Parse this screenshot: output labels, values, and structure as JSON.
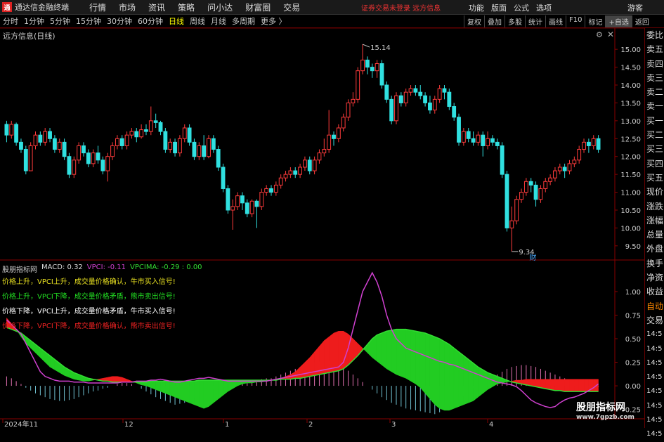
{
  "app": {
    "name": "通达信金融终端",
    "logo_char": "通"
  },
  "top_menu": [
    "行情",
    "市场",
    "资讯",
    "策略",
    "问小达",
    "财富圈",
    "交易"
  ],
  "warning": "证券交易未登录  远方信息",
  "right_menu": [
    "功能",
    "版面",
    "公式",
    "选项"
  ],
  "guest_label": "游客",
  "periods": [
    {
      "label": "分时",
      "active": false
    },
    {
      "label": "1分钟",
      "active": false
    },
    {
      "label": "5分钟",
      "active": false
    },
    {
      "label": "15分钟",
      "active": false
    },
    {
      "label": "30分钟",
      "active": false
    },
    {
      "label": "60分钟",
      "active": false
    },
    {
      "label": "日线",
      "active": true
    },
    {
      "label": "周线",
      "active": false
    },
    {
      "label": "月线",
      "active": false
    },
    {
      "label": "多周期",
      "active": false
    },
    {
      "label": "更多 〉",
      "active": false
    }
  ],
  "tools": [
    {
      "label": "复权",
      "hl": false
    },
    {
      "label": "叠加",
      "hl": false
    },
    {
      "label": "多股",
      "hl": false
    },
    {
      "label": "统计",
      "hl": false
    },
    {
      "label": "画线",
      "hl": false
    },
    {
      "label": "F10",
      "hl": false
    },
    {
      "label": "标记",
      "hl": false
    },
    {
      "label": "+自选",
      "hl": true
    },
    {
      "label": "返回",
      "hl": false
    }
  ],
  "chart_title": "远方信息(日线)",
  "side_labels": [
    {
      "t": "委比",
      "c": "normal"
    },
    {
      "t": "卖五",
      "c": "normal"
    },
    {
      "t": "卖四",
      "c": "normal"
    },
    {
      "t": "卖三",
      "c": "normal"
    },
    {
      "t": "卖二",
      "c": "normal"
    },
    {
      "t": "卖一",
      "c": "normal"
    },
    {
      "t": "买一",
      "c": "normal"
    },
    {
      "t": "买二",
      "c": "normal"
    },
    {
      "t": "买三",
      "c": "normal"
    },
    {
      "t": "买四",
      "c": "normal"
    },
    {
      "t": "买五",
      "c": "normal"
    },
    {
      "t": "现价",
      "c": "normal"
    },
    {
      "t": "涨跌",
      "c": "normal"
    },
    {
      "t": "涨幅",
      "c": "normal"
    },
    {
      "t": "总量",
      "c": "normal"
    },
    {
      "t": "外盘",
      "c": "normal"
    },
    {
      "t": "换手",
      "c": "normal"
    },
    {
      "t": "净资",
      "c": "normal"
    },
    {
      "t": "收益",
      "c": "normal"
    },
    {
      "t": "自动",
      "c": "orange"
    },
    {
      "t": "交易",
      "c": "normal"
    },
    {
      "t": "14:5",
      "c": "sub"
    },
    {
      "t": "14:5",
      "c": "sub"
    },
    {
      "t": "14:5",
      "c": "sub"
    },
    {
      "t": "14:5",
      "c": "sub"
    },
    {
      "t": "14:5",
      "c": "sub"
    },
    {
      "t": "14:5",
      "c": "sub"
    },
    {
      "t": "14:5",
      "c": "sub"
    },
    {
      "t": "14:5",
      "c": "sub"
    }
  ],
  "indicator": {
    "name": "股朋指标网",
    "macd": "MACD: 0.32",
    "vpci": "VPCI: -0.11",
    "vpcima": "VPCIMA: -0.29 : 0.00"
  },
  "legend": [
    {
      "t": "价格上升，VPCI上升，成交量价格确认，牛市买入信号!",
      "color": "#e8e020"
    },
    {
      "t": "价格上升，VPCI下降，成交量价格矛盾，熊市卖出信号!",
      "color": "#22dd22"
    },
    {
      "t": "价格下降，VPCI上升，成交量价格矛盾，牛市买入信号!",
      "color": "#ffffff"
    },
    {
      "t": "价格下降，VPCI下降，成交量价格确认，熊市卖出信号!",
      "color": "#ee2222"
    }
  ],
  "watermark": {
    "line1": "股朋指标网",
    "line2": "www.7gpzb.com"
  },
  "colors": {
    "up": "#ff3b3b",
    "down": "#30e0e0",
    "magenta": "#d040d0",
    "green_line": "#33dd33"
  },
  "chart_data": {
    "type": "candlestick",
    "price_axis": {
      "min": 9.5,
      "max": 15.0,
      "ticks": [
        15.0,
        14.5,
        14.0,
        13.5,
        13.0,
        12.5,
        12.0,
        11.5,
        11.0,
        10.5,
        10.0,
        9.5
      ]
    },
    "annotations": {
      "high": "15.14",
      "low": "9.34",
      "low_marker": "财"
    },
    "x_labels": [
      "2024年11",
      "12",
      "1",
      "2",
      "3",
      "4"
    ],
    "indicator_axis": {
      "min": -0.25,
      "max": 1.25,
      "ticks": [
        1.0,
        0.75,
        0.5,
        0.25,
        0.0,
        -0.25
      ]
    },
    "candles": [
      [
        12.9,
        12.6,
        13.0,
        12.4
      ],
      [
        12.6,
        12.9,
        13.0,
        12.5
      ],
      [
        12.9,
        12.4,
        12.95,
        12.3
      ],
      [
        12.4,
        12.2,
        12.5,
        12.1
      ],
      [
        12.2,
        11.6,
        12.3,
        11.5
      ],
      [
        11.6,
        12.3,
        12.4,
        11.6
      ],
      [
        12.3,
        12.6,
        12.7,
        12.2
      ],
      [
        12.6,
        12.4,
        12.7,
        12.3
      ],
      [
        12.4,
        12.7,
        12.8,
        12.3
      ],
      [
        12.7,
        12.5,
        12.8,
        12.4
      ],
      [
        12.5,
        12.2,
        12.6,
        12.1
      ],
      [
        12.2,
        12.4,
        12.5,
        12.1
      ],
      [
        12.4,
        12.0,
        12.5,
        11.9
      ],
      [
        12.0,
        11.5,
        12.1,
        11.4
      ],
      [
        11.5,
        11.9,
        12.0,
        11.4
      ],
      [
        11.9,
        12.3,
        12.4,
        11.8
      ],
      [
        12.3,
        12.1,
        12.4,
        12.0
      ],
      [
        12.1,
        11.8,
        12.2,
        11.7
      ],
      [
        11.8,
        12.1,
        12.2,
        11.7
      ],
      [
        12.1,
        11.9,
        12.3,
        11.8
      ],
      [
        11.9,
        11.6,
        12.0,
        11.5
      ],
      [
        11.6,
        12.0,
        12.1,
        11.3
      ],
      [
        12.0,
        12.3,
        12.4,
        11.9
      ],
      [
        12.3,
        12.5,
        12.6,
        12.2
      ],
      [
        12.5,
        12.3,
        12.6,
        12.2
      ],
      [
        12.3,
        12.6,
        12.7,
        12.2
      ],
      [
        12.6,
        12.7,
        12.8,
        12.5
      ],
      [
        12.7,
        12.55,
        12.8,
        12.4
      ],
      [
        12.55,
        12.75,
        12.9,
        12.5
      ],
      [
        12.75,
        12.7,
        12.9,
        12.6
      ],
      [
        12.7,
        13.0,
        13.4,
        12.6
      ],
      [
        13.0,
        12.95,
        13.2,
        12.8
      ],
      [
        12.95,
        12.7,
        13.0,
        12.6
      ],
      [
        12.7,
        12.2,
        12.8,
        12.1
      ],
      [
        12.2,
        12.4,
        12.5,
        12.1
      ],
      [
        12.4,
        12.1,
        12.5,
        12.0
      ],
      [
        12.1,
        12.5,
        12.6,
        12.0
      ],
      [
        12.5,
        12.8,
        12.9,
        12.4
      ],
      [
        12.8,
        12.4,
        12.9,
        12.3
      ],
      [
        12.4,
        12.0,
        12.5,
        11.9
      ],
      [
        12.0,
        12.3,
        12.4,
        11.9
      ],
      [
        12.3,
        12.0,
        12.6,
        11.9
      ],
      [
        12.0,
        12.5,
        12.6,
        11.95
      ],
      [
        12.5,
        12.2,
        12.6,
        12.1
      ],
      [
        12.2,
        11.7,
        12.3,
        11.6
      ],
      [
        11.7,
        11.1,
        11.8,
        11.0
      ],
      [
        11.1,
        10.5,
        11.2,
        10.4
      ],
      [
        10.5,
        10.6,
        10.8,
        9.95
      ],
      [
        10.6,
        10.9,
        11.0,
        10.5
      ],
      [
        10.9,
        10.7,
        11.0,
        10.5
      ],
      [
        10.7,
        10.4,
        10.8,
        10.3
      ],
      [
        10.4,
        10.75,
        10.8,
        10.3
      ],
      [
        10.75,
        10.6,
        10.8,
        10.0
      ],
      [
        10.6,
        11.0,
        11.1,
        10.5
      ],
      [
        11.0,
        11.1,
        11.2,
        10.9
      ],
      [
        11.1,
        11.0,
        11.2,
        10.9
      ],
      [
        11.0,
        11.2,
        11.3,
        10.9
      ],
      [
        11.2,
        11.4,
        11.5,
        11.1
      ],
      [
        11.4,
        11.5,
        11.6,
        11.3
      ],
      [
        11.5,
        11.6,
        11.7,
        11.4
      ],
      [
        11.6,
        11.5,
        11.7,
        11.4
      ],
      [
        11.5,
        11.7,
        11.8,
        11.4
      ],
      [
        11.7,
        11.9,
        12.0,
        11.6
      ],
      [
        11.9,
        11.6,
        12.0,
        11.5
      ],
      [
        11.6,
        11.9,
        12.0,
        11.5
      ],
      [
        11.9,
        12.1,
        12.2,
        11.8
      ],
      [
        12.1,
        12.2,
        12.5,
        12.0
      ],
      [
        12.2,
        12.6,
        13.3,
        12.1
      ],
      [
        12.6,
        12.5,
        12.7,
        12.3
      ],
      [
        12.5,
        12.8,
        12.9,
        12.4
      ],
      [
        12.8,
        13.1,
        13.2,
        12.7
      ],
      [
        13.1,
        13.5,
        13.6,
        13.0
      ],
      [
        13.5,
        13.6,
        13.8,
        13.4
      ],
      [
        13.6,
        14.4,
        14.5,
        13.5
      ],
      [
        14.4,
        14.7,
        15.14,
        14.3
      ],
      [
        14.7,
        14.5,
        14.8,
        14.3
      ],
      [
        14.5,
        14.4,
        14.6,
        14.2
      ],
      [
        14.4,
        14.6,
        14.7,
        14.2
      ],
      [
        14.6,
        14.0,
        14.7,
        13.9
      ],
      [
        14.0,
        13.6,
        14.1,
        13.5
      ],
      [
        13.6,
        13.0,
        13.7,
        12.9
      ],
      [
        13.0,
        13.7,
        13.8,
        12.9
      ],
      [
        13.7,
        13.5,
        13.8,
        13.4
      ],
      [
        13.5,
        13.8,
        13.9,
        13.4
      ],
      [
        13.8,
        13.9,
        14.0,
        13.7
      ],
      [
        13.9,
        13.8,
        14.0,
        13.7
      ],
      [
        13.8,
        13.7,
        14.0,
        13.6
      ],
      [
        13.7,
        13.5,
        13.8,
        13.4
      ],
      [
        13.5,
        13.3,
        13.7,
        13.2
      ],
      [
        13.3,
        13.6,
        13.7,
        13.2
      ],
      [
        13.6,
        13.9,
        14.0,
        13.5
      ],
      [
        13.9,
        13.8,
        14.0,
        13.6
      ],
      [
        13.8,
        13.4,
        13.9,
        13.3
      ],
      [
        13.4,
        13.1,
        13.5,
        13.0
      ],
      [
        13.1,
        12.4,
        13.2,
        12.3
      ],
      [
        12.4,
        12.7,
        12.8,
        12.3
      ],
      [
        12.7,
        12.5,
        12.8,
        12.4
      ],
      [
        12.5,
        12.4,
        12.7,
        12.3
      ],
      [
        12.4,
        12.6,
        12.7,
        12.3
      ],
      [
        12.6,
        12.3,
        12.7,
        12.0
      ],
      [
        12.3,
        12.5,
        12.7,
        12.2
      ],
      [
        12.5,
        12.4,
        12.6,
        12.3
      ],
      [
        12.4,
        12.3,
        12.5,
        12.2
      ],
      [
        12.3,
        11.5,
        12.4,
        11.4
      ],
      [
        11.5,
        10.0,
        11.6,
        9.9
      ],
      [
        10.0,
        10.2,
        10.6,
        9.34
      ],
      [
        10.2,
        10.8,
        10.9,
        10.1
      ],
      [
        10.8,
        11.0,
        11.1,
        10.7
      ],
      [
        11.0,
        11.3,
        11.4,
        10.9
      ],
      [
        11.3,
        11.2,
        11.4,
        11.0
      ],
      [
        11.2,
        10.8,
        11.3,
        10.6
      ],
      [
        10.8,
        11.1,
        11.2,
        10.7
      ],
      [
        11.1,
        11.3,
        11.4,
        11.0
      ],
      [
        11.3,
        11.4,
        11.5,
        11.2
      ],
      [
        11.4,
        11.6,
        11.7,
        11.3
      ],
      [
        11.6,
        11.7,
        11.8,
        11.5
      ],
      [
        11.7,
        11.6,
        11.8,
        11.4
      ],
      [
        11.6,
        11.8,
        11.9,
        11.5
      ],
      [
        11.8,
        11.9,
        12.0,
        11.7
      ],
      [
        11.9,
        12.2,
        12.3,
        11.8
      ],
      [
        12.2,
        12.4,
        12.5,
        12.1
      ],
      [
        12.4,
        12.3,
        12.5,
        12.1
      ],
      [
        12.3,
        12.5,
        12.6,
        12.2
      ],
      [
        12.5,
        12.2,
        12.6,
        12.1
      ]
    ],
    "vpci": [
      0.7,
      0.65,
      0.6,
      0.55,
      0.45,
      0.35,
      0.25,
      0.15,
      0.1,
      0.08,
      0.06,
      0.05,
      0.05,
      0.05,
      0.04,
      0.04,
      0.04,
      0.03,
      0.03,
      0.03,
      0.03,
      0.03,
      0.03,
      0.03,
      0.04,
      0.04,
      0.04,
      0.05,
      0.05,
      0.05,
      0.06,
      0.06,
      0.07,
      0.06,
      0.05,
      0.04,
      0.04,
      0.05,
      0.06,
      0.07,
      0.08,
      0.08,
      0.09,
      0.08,
      0.07,
      0.06,
      0.05,
      0.05,
      0.05,
      0.05,
      0.05,
      0.05,
      0.05,
      0.05,
      0.05,
      0.06,
      0.07,
      0.08,
      0.09,
      0.1,
      0.11,
      0.12,
      0.13,
      0.14,
      0.15,
      0.16,
      0.17,
      0.18,
      0.19,
      0.2,
      0.25,
      0.4,
      0.6,
      0.8,
      1.0,
      1.1,
      1.2,
      1.1,
      0.95,
      0.75,
      0.6,
      0.5,
      0.45,
      0.4,
      0.38,
      0.36,
      0.34,
      0.32,
      0.3,
      0.28,
      0.26,
      0.25,
      0.23,
      0.22,
      0.2,
      0.18,
      0.16,
      0.14,
      0.12,
      0.1,
      0.08,
      0.06,
      0.04,
      0.03,
      0.02,
      0.01,
      -0.01,
      -0.05,
      -0.1,
      -0.15,
      -0.18,
      -0.2,
      -0.22,
      -0.23,
      -0.22,
      -0.18,
      -0.15,
      -0.13,
      -0.12,
      -0.1,
      -0.08,
      -0.05,
      -0.02,
      0.02
    ],
    "vpcima": [
      0.62,
      0.6,
      0.58,
      0.56,
      0.52,
      0.48,
      0.44,
      0.4,
      0.36,
      0.32,
      0.28,
      0.24,
      0.2,
      0.17,
      0.14,
      0.12,
      0.1,
      0.08,
      0.07,
      0.06,
      0.05,
      0.05,
      0.04,
      0.04,
      0.04,
      0.04,
      0.04,
      0.04,
      0.04,
      0.04,
      0.05,
      0.05,
      0.05,
      0.05,
      0.05,
      0.05,
      0.05,
      0.05,
      0.05,
      0.05,
      0.06,
      0.06,
      0.06,
      0.06,
      0.06,
      0.06,
      0.06,
      0.06,
      0.06,
      0.06,
      0.06,
      0.06,
      0.06,
      0.06,
      0.06,
      0.06,
      0.06,
      0.07,
      0.07,
      0.07,
      0.08,
      0.08,
      0.09,
      0.1,
      0.11,
      0.12,
      0.13,
      0.14,
      0.15,
      0.16,
      0.18,
      0.22,
      0.27,
      0.32,
      0.38,
      0.44,
      0.5,
      0.54,
      0.56,
      0.58,
      0.59,
      0.6,
      0.6,
      0.6,
      0.59,
      0.58,
      0.57,
      0.56,
      0.54,
      0.52,
      0.5,
      0.47,
      0.44,
      0.4,
      0.36,
      0.32,
      0.28,
      0.24,
      0.2,
      0.17,
      0.14,
      0.12,
      0.1,
      0.08,
      0.06,
      0.04,
      0.03,
      0.02,
      0.01,
      0.0,
      -0.01,
      -0.02,
      -0.03,
      -0.04,
      -0.05,
      -0.05,
      -0.06,
      -0.06,
      -0.06,
      -0.06,
      -0.06,
      -0.06,
      -0.06,
      -0.06
    ],
    "macd_band": [
      0.72,
      0.66,
      0.6,
      0.52,
      0.45,
      0.4,
      0.35,
      0.3,
      0.25,
      0.2,
      0.17,
      0.14,
      0.11,
      0.09,
      0.07,
      0.06,
      0.05,
      0.05,
      0.06,
      0.07,
      0.08,
      0.09,
      0.1,
      0.1,
      0.09,
      0.07,
      0.05,
      0.03,
      0.01,
      0.0,
      -0.02,
      -0.04,
      -0.06,
      -0.08,
      -0.1,
      -0.12,
      -0.14,
      -0.16,
      -0.18,
      -0.2,
      -0.22,
      -0.24,
      -0.22,
      -0.18,
      -0.14,
      -0.1,
      -0.06,
      -0.03,
      0.0,
      0.02,
      0.03,
      0.03,
      0.04,
      0.04,
      0.05,
      0.06,
      0.07,
      0.08,
      0.1,
      0.12,
      0.15,
      0.2,
      0.25,
      0.3,
      0.36,
      0.42,
      0.48,
      0.52,
      0.56,
      0.58,
      0.58,
      0.55,
      0.5,
      0.45,
      0.4,
      0.35,
      0.3,
      0.26,
      0.22,
      0.18,
      0.15,
      0.12,
      0.1,
      0.08,
      0.05,
      0.02,
      -0.02,
      -0.08,
      -0.14,
      -0.2,
      -0.24,
      -0.26,
      -0.26,
      -0.24,
      -0.22,
      -0.2,
      -0.18,
      -0.16,
      -0.12,
      -0.08,
      -0.04,
      -0.01,
      0.02,
      0.03,
      0.04,
      0.05,
      0.06,
      0.06,
      0.07,
      0.07,
      0.07,
      0.07,
      0.07,
      0.07,
      0.07,
      0.07,
      0.07,
      0.07,
      0.07,
      0.07,
      0.07,
      0.07,
      0.07,
      0.07
    ],
    "macd_hist": [
      0.1,
      0.08,
      0.05,
      0.02,
      -0.02,
      -0.05,
      -0.08,
      -0.1,
      -0.12,
      -0.14,
      -0.15,
      -0.16,
      -0.16,
      -0.15,
      -0.14,
      -0.12,
      -0.1,
      -0.08,
      -0.06,
      -0.05,
      -0.03,
      -0.02,
      0.0,
      0.02,
      0.03,
      0.03,
      0.02,
      0.0,
      -0.03,
      -0.06,
      -0.09,
      -0.12,
      -0.14,
      -0.16,
      -0.18,
      -0.2,
      -0.19,
      -0.18,
      -0.16,
      -0.13,
      -0.1,
      -0.08,
      -0.05,
      -0.03,
      -0.02,
      -0.01,
      0.0,
      0.01,
      0.02,
      0.03,
      0.04,
      0.05,
      0.06,
      0.07,
      0.08,
      0.08,
      0.1,
      0.12,
      0.14,
      0.16,
      0.18,
      0.2,
      0.22,
      0.24,
      0.25,
      0.26,
      0.27,
      0.26,
      0.24,
      0.22,
      0.2,
      0.16,
      0.12,
      0.08,
      0.04,
      0.0,
      -0.04,
      -0.08,
      -0.12,
      -0.15,
      -0.18,
      -0.2,
      -0.22,
      -0.24,
      -0.25,
      -0.26,
      -0.27,
      -0.28,
      -0.29,
      -0.3,
      -0.28,
      -0.26,
      -0.22,
      -0.18,
      -0.14,
      -0.1,
      -0.06,
      -0.03,
      0.0,
      0.03,
      0.06,
      0.09,
      0.12,
      0.15,
      0.18,
      0.2,
      0.21,
      0.22,
      0.22,
      0.21,
      0.2,
      0.18,
      0.16,
      0.14,
      0.12,
      0.1,
      0.08,
      0.06,
      0.04,
      0.02,
      0.0,
      -0.01,
      -0.01,
      -0.01
    ]
  }
}
